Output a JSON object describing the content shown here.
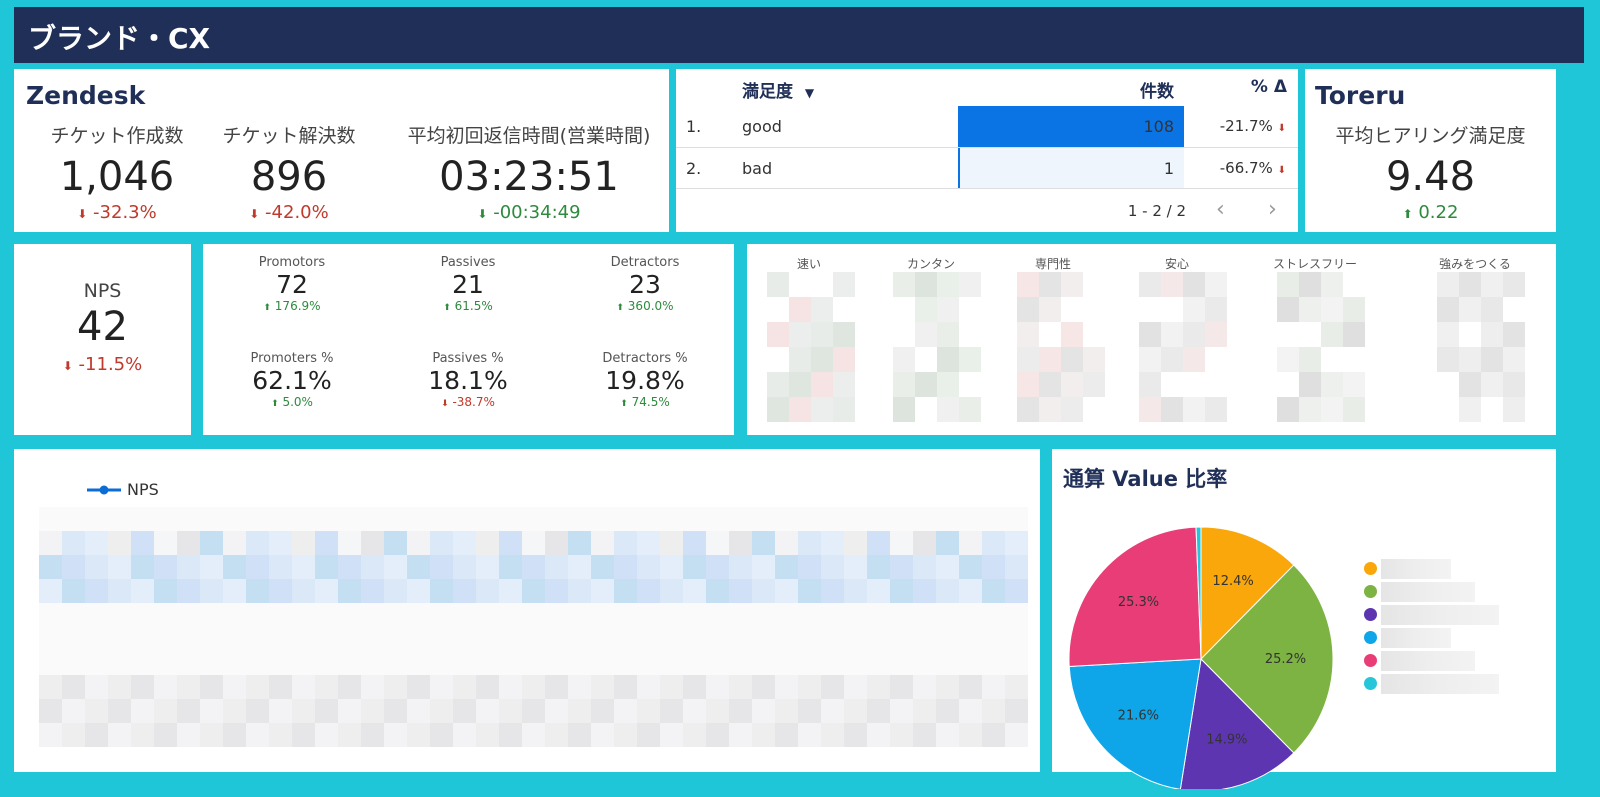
{
  "header": {
    "title": "ブランド・CX"
  },
  "zendesk": {
    "title": "Zendesk",
    "metrics": [
      {
        "label": "チケット作成数",
        "value": "1,046",
        "change": "-32.3%",
        "dir": "down"
      },
      {
        "label": "チケット解決数",
        "value": "896",
        "change": "-42.0%",
        "dir": "down"
      },
      {
        "label": "平均初回返信時間(営業時間)",
        "value": "03:23:51",
        "change": "-00:34:49",
        "dir": "down-good"
      }
    ]
  },
  "satisfaction_table": {
    "columns": [
      "満足度",
      "件数",
      "% Δ"
    ],
    "sort_icon": "sort-desc-icon",
    "rows": [
      {
        "index": "1.",
        "label": "good",
        "count": "108",
        "count_value": 108,
        "delta": "-21.7%"
      },
      {
        "index": "2.",
        "label": "bad",
        "count": "1",
        "count_value": 1,
        "delta": "-66.7%"
      }
    ],
    "pagination": "1 - 2 / 2",
    "bar_color": "#0b74e5",
    "max_count": 108
  },
  "toreru": {
    "title": "Toreru",
    "label": "平均ヒアリング満足度",
    "value": "9.48",
    "change": "0.22",
    "dir": "up"
  },
  "nps": {
    "label": "NPS",
    "value": "42",
    "change": "-11.5%",
    "dir": "down"
  },
  "breakdown": [
    {
      "label": "Promotors",
      "value": "72",
      "change": "176.9%",
      "dir": "up"
    },
    {
      "label": "Passives",
      "value": "21",
      "change": "61.5%",
      "dir": "up"
    },
    {
      "label": "Detractors",
      "value": "23",
      "change": "360.0%",
      "dir": "up"
    },
    {
      "label": "Promoters %",
      "value": "62.1%",
      "change": "5.0%",
      "dir": "up"
    },
    {
      "label": "Passives %",
      "value": "18.1%",
      "change": "-38.7%",
      "dir": "down"
    },
    {
      "label": "Detractors %",
      "value": "19.8%",
      "change": "74.5%",
      "dir": "up"
    }
  ],
  "heatmap": {
    "columns": [
      "速い",
      "カンタン",
      "専門性",
      "安心",
      "ストレスフリー",
      "強みをつくる"
    ]
  },
  "nps_trend": {
    "legend": "NPS",
    "line_color": "#0b6cd6"
  },
  "value_pie": {
    "title": "通算 Value 比率",
    "chart_data": {
      "type": "pie",
      "title": "通算 Value 比率",
      "values": [
        12.4,
        25.2,
        14.9,
        21.6,
        25.3,
        0.6
      ],
      "labels": [
        "12.4%",
        "25.2%",
        "14.9%",
        "21.6%",
        "25.3%",
        ""
      ],
      "colors": [
        "#f9a70a",
        "#7cb342",
        "#5e35b1",
        "#0ea5e9",
        "#e93d77",
        "#26c6da"
      ]
    }
  }
}
